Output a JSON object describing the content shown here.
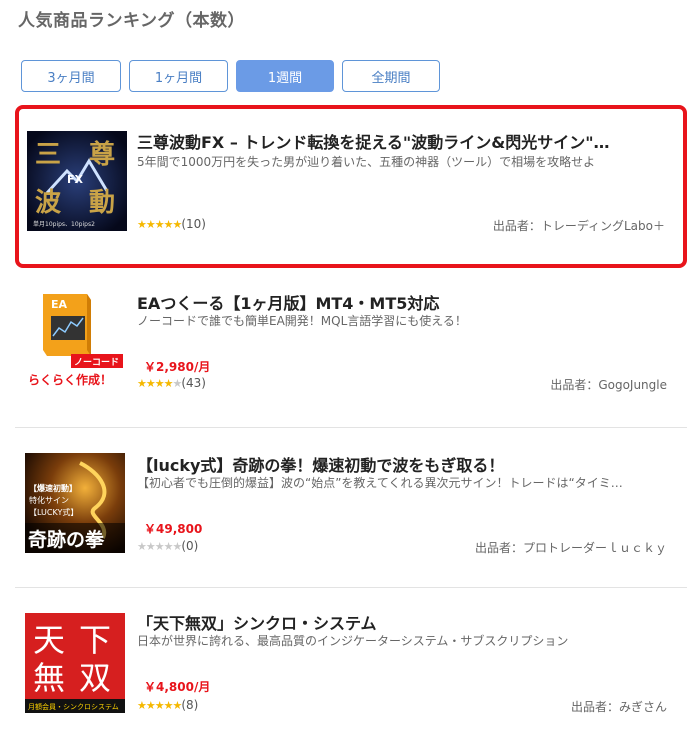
{
  "heading": "人気商品ランキング（本数）",
  "tabs": [
    {
      "label": "3ヶ月間",
      "active": false
    },
    {
      "label": "1ヶ月間",
      "active": false
    },
    {
      "label": "1週間",
      "active": true
    },
    {
      "label": "全期間",
      "active": false
    }
  ],
  "items": [
    {
      "title": "三尊波動FX – トレンド転換を捉える\"波動ライン&閃光サイン\"…",
      "description": "5年間で1000万円を失った男が辿り着いた、五種の神器（ツール）で相場を攻略せよ",
      "price": "",
      "stars": 5,
      "review_count": "(10)",
      "seller": "出品者：トレーディングLabo＋",
      "thumb_text": [
        "三",
        "尊",
        "波",
        "動",
        "FX",
        "単月10pips、10pips2"
      ],
      "highlighted": true
    },
    {
      "title": "EAつくーる【1ヶ月版】MT4・MT5対応",
      "description": "ノーコードで誰でも簡単EA開発！MQL言語学習にも使える！",
      "price": "￥2,980/月",
      "stars": 4,
      "review_count": "(43)",
      "seller": "出品者：GogoJungle",
      "thumb_text": [
        "EA",
        "ノーコード",
        "らくらく作成！"
      ],
      "highlighted": false
    },
    {
      "title": "【lucky式】奇跡の拳！爆速初動で波をもぎ取る！",
      "description": "【初心者でも圧倒的爆益】波の“始点”を教えてくれる異次元サイン！トレードは“タイミ…",
      "price": "￥49,800",
      "stars": 0,
      "review_count": "(0)",
      "seller": "出品者：プロトレーダーｌｕｃｋｙ",
      "thumb_text": [
        "【爆速初動】",
        "特化サイン",
        "【LUCKY式】",
        "奇跡の拳"
      ],
      "highlighted": false
    },
    {
      "title": "「天下無双」シンクロ・システム",
      "description": "日本が世界に誇れる、最高品質のインジケーターシステム・サブスクリプション",
      "price": "￥4,800/月",
      "stars": 5,
      "review_count": "(8)",
      "seller": "出品者：みぎさん",
      "thumb_text": [
        "天",
        "下",
        "無",
        "双",
        "月額会員・シンクロシステム"
      ],
      "highlighted": false
    }
  ],
  "colors": {
    "accent_blue": "#6b9be6",
    "highlight_red": "#e8141b",
    "star": "#f5b800"
  }
}
